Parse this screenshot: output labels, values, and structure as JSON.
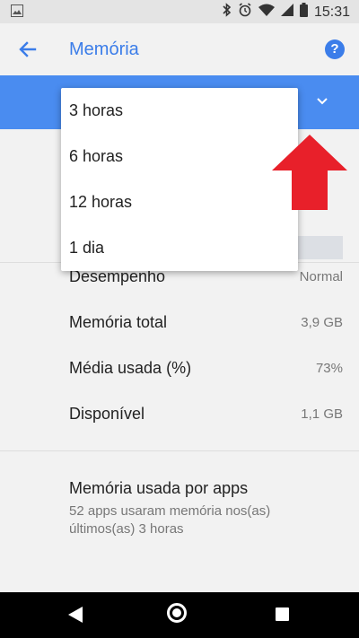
{
  "status_bar": {
    "time": "15:31",
    "icons": [
      "image-icon",
      "bluetooth-icon",
      "alarm-icon",
      "wifi-icon",
      "signal-icon",
      "battery-icon"
    ]
  },
  "app_bar": {
    "title": "Memória",
    "back_icon": "arrow-back-icon",
    "help_label": "?"
  },
  "dropdown": {
    "options": [
      "3 horas",
      "6 horas",
      "12 horas",
      "1 dia"
    ]
  },
  "stats": [
    {
      "label": "Desempenho",
      "value": "Normal"
    },
    {
      "label": "Memória total",
      "value": "3,9 GB"
    },
    {
      "label": "Média usada (%)",
      "value": "73%"
    },
    {
      "label": "Disponível",
      "value": "1,1 GB"
    }
  ],
  "apps_section": {
    "title": "Memória usada por apps",
    "subtitle": "52 apps usaram memória nos(as) últimos(as) 3 horas"
  },
  "colors": {
    "accent": "#3b7de9",
    "band": "#4a8cf0",
    "annotation_arrow": "#e8202a"
  }
}
